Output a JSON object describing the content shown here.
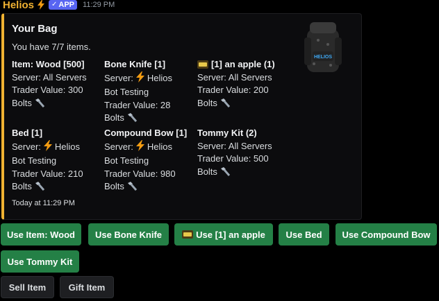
{
  "message": {
    "bot_name": "Helios",
    "badge": "APP",
    "time": "11:29 PM"
  },
  "embed": {
    "accent_color": "#f0b232",
    "title": "Your Bag",
    "description": "You have 7/7 items.",
    "thumbnail_text": "HELIOS",
    "footer": "Today at 11:29 PM",
    "fields": [
      {
        "name": "Item: Wood [500]",
        "server": "Server: All Servers",
        "trader": "Trader Value: 300",
        "bolts": "Bolts"
      },
      {
        "name": "Bone Knife [1]",
        "server_prefix": "Server:",
        "server_name": "Helios",
        "server_tail": "Bot Testing",
        "trader": "Trader Value: 28",
        "bolts": "Bolts"
      },
      {
        "name": "[1] an apple (1)",
        "server": "Server: All Servers",
        "trader": "Trader Value: 200",
        "bolts": "Bolts"
      },
      {
        "name": "Bed [1]",
        "server_prefix": "Server:",
        "server_name": "Helios",
        "server_tail": "Bot Testing",
        "trader": "Trader Value: 210",
        "bolts": "Bolts"
      },
      {
        "name": "Compound Bow [1]",
        "server_prefix": "Server:",
        "server_name": "Helios",
        "server_tail": "Bot Testing",
        "trader": "Trader Value: 980",
        "bolts": "Bolts"
      },
      {
        "name": "Tommy Kit (2)",
        "server": "Server: All Servers",
        "trader": "Trader Value: 500",
        "bolts": "Bolts"
      }
    ]
  },
  "buttons": {
    "use_wood": "Use Item: Wood",
    "use_bone_knife": "Use Bone Knife",
    "use_apple": "Use [1] an apple",
    "use_bed": "Use Bed",
    "use_compound_bow": "Use Compound Bow",
    "use_tommy_kit": "Use Tommy Kit",
    "sell_item": "Sell Item",
    "gift_item": "Gift Item"
  },
  "icons": {
    "lightning": "lightning-bolt-icon",
    "bolts": "bolts-screw-icon",
    "apple": "battle-pass-icon",
    "check": "check-icon"
  }
}
